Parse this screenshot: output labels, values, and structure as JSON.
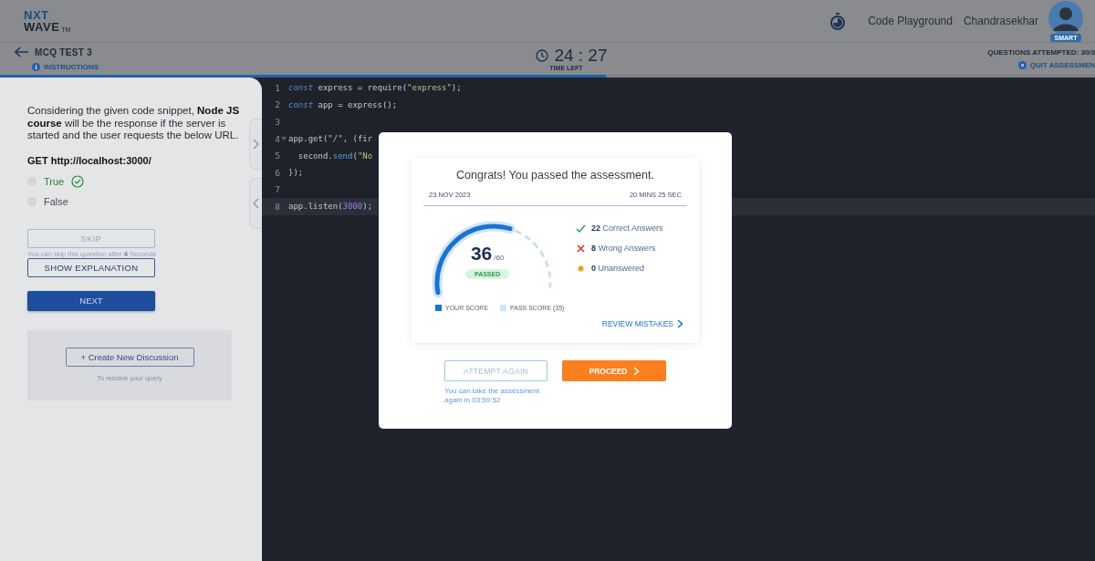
{
  "header": {
    "logo": {
      "line1": "NXT",
      "line2": "WAVE",
      "mark": "TM"
    },
    "links": [
      "Code Playground"
    ],
    "user": {
      "name": "Chandrasekhar",
      "badge": "SMART"
    }
  },
  "test_bar": {
    "title": "MCQ TEST 3",
    "instructions": "INSTRUCTIONS",
    "timer": "24 : 27",
    "timer_label": "TIME LEFT",
    "attempted": "QUESTIONS ATTEMPTED: 30/3",
    "quit": "QUIT ASSESSMEN",
    "progress": {
      "level": 0.553
    }
  },
  "question": {
    "text": "Considering the given code snippet, **Node JS course** will be the response if the server is started and the user requests the below URL.",
    "url": "GET http://localhost:3000/",
    "options": [
      {
        "label": "True",
        "selected": false,
        "correct": true
      },
      {
        "label": "False",
        "selected": false,
        "correct": false
      }
    ],
    "skip": {
      "label": "SKIP",
      "disabled": true
    },
    "skip_note": "You can skip this question after **4** Seconds",
    "explanation": "SHOW EXPLANATION",
    "next": "NEXT",
    "discussion": {
      "button": "+ Create New Discussion",
      "note": "To resolve your query"
    }
  },
  "code": {
    "lines": [
      {
        "number": "1",
        "fold": false,
        "highlighted": false,
        "tokens": [
          {
            "kind": "keyword",
            "text": "const"
          },
          {
            "kind": "plain",
            "text": " express = require("
          },
          {
            "kind": "string",
            "text": "\"express\""
          },
          {
            "kind": "plain",
            "text": ");"
          }
        ]
      },
      {
        "number": "2",
        "fold": false,
        "highlighted": false,
        "tokens": [
          {
            "kind": "keyword",
            "text": "const"
          },
          {
            "kind": "plain",
            "text": " app = express();"
          }
        ]
      },
      {
        "number": "3",
        "fold": false,
        "highlighted": false
      },
      {
        "number": "4",
        "fold": true,
        "highlighted": false,
        "tokens": [
          {
            "kind": "plain",
            "text": "app.get("
          },
          {
            "kind": "string",
            "text": "\"/\""
          },
          {
            "kind": "plain",
            "text": ", (fir"
          }
        ]
      },
      {
        "number": "5",
        "fold": false,
        "highlighted": false,
        "tokens": [
          {
            "kind": "plain",
            "text": "  second."
          },
          {
            "kind": "func",
            "text": "send"
          },
          {
            "kind": "plain",
            "text": "("
          },
          {
            "kind": "string",
            "text": "\"No"
          }
        ]
      },
      {
        "number": "6",
        "fold": false,
        "highlighted": false,
        "tokens": [
          {
            "kind": "plain",
            "text": "});"
          }
        ]
      },
      {
        "number": "7",
        "fold": false,
        "highlighted": false
      },
      {
        "number": "8",
        "fold": false,
        "highlighted": true,
        "tokens": [
          {
            "kind": "plain",
            "text": "app.listen("
          },
          {
            "kind": "number",
            "text": "3000"
          },
          {
            "kind": "plain",
            "text": ");"
          }
        ]
      }
    ]
  },
  "result": {
    "title": "Congrats! You passed the assessment.",
    "date": "23 NOV 2023",
    "duration": "20 MINS 25 SEC",
    "score": "36",
    "total": "/60",
    "gauge": {
      "level": 0.6
    },
    "status": "PASSED",
    "stats": [
      {
        "kind": "correct",
        "count": "22",
        "label": "Correct Answers"
      },
      {
        "kind": "wrong",
        "count": "8",
        "label": "Wrong Answers"
      },
      {
        "kind": "unanswered",
        "count": "0",
        "label": "Unanswered"
      }
    ],
    "legend": [
      {
        "kind": "score",
        "label": "YOUR SCORE"
      },
      {
        "kind": "pass",
        "label": "PASS SCORE (35)"
      }
    ],
    "review": "REVIEW MISTAKES",
    "attempt_again": {
      "label": "ATTEMPT AGAIN",
      "disabled": true
    },
    "retry_note": "You can take the assessment again in 03:59:52",
    "proceed": "PROCEED"
  }
}
